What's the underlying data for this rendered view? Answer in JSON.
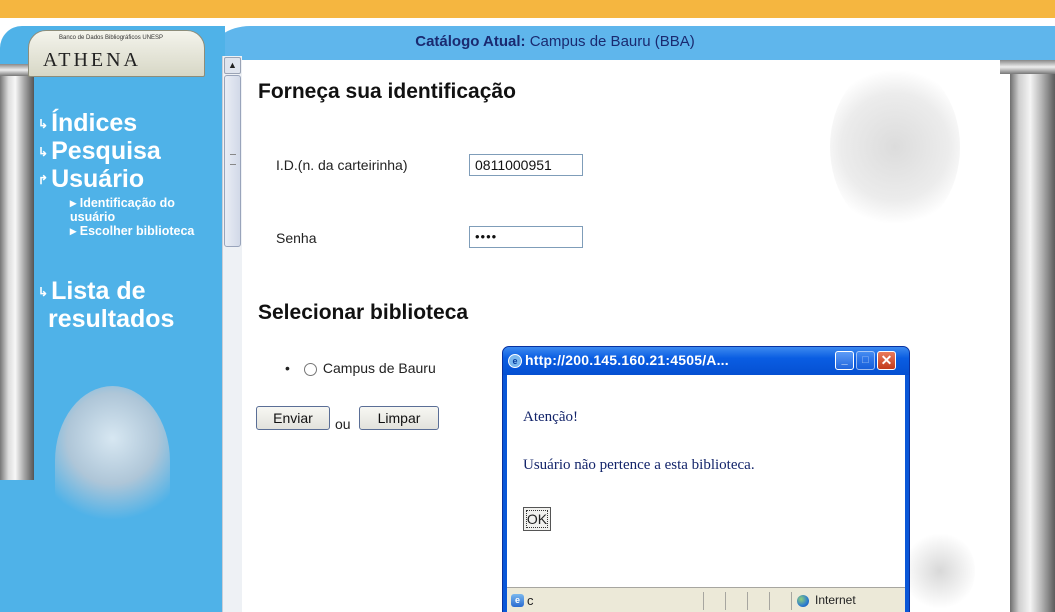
{
  "header": {
    "catalog_label": "Catálogo Atual:",
    "catalog_value": "Campus de Bauru (BBA)"
  },
  "logo": {
    "small_text": "Banco de Dados Bibliográficos UNESP",
    "name": "ATHENA"
  },
  "nav": {
    "arrow": "↳",
    "items": [
      {
        "label": "Índices"
      },
      {
        "label": "Pesquisa"
      },
      {
        "label": "Usuário"
      },
      {
        "label": "Lista de resultados"
      }
    ],
    "sub_items": [
      {
        "label": "Identificação do usuário"
      },
      {
        "label": "Escolher biblioteca"
      }
    ]
  },
  "main": {
    "heading_ident": "Forneça sua identificação",
    "id_label": "I.D.(n. da carteirinha)",
    "id_value": "0811000951",
    "senha_label": "Senha",
    "senha_value": "••••",
    "heading_lib": "Selecionar biblioteca",
    "library_option": "Campus de Bauru",
    "enviar": "Enviar",
    "ou": "ou",
    "limpar": "Limpar"
  },
  "dialog": {
    "title": "http://200.145.160.21:4505/A...",
    "atencao": "Atenção!",
    "message": "Usuário não pertence a esta biblioteca.",
    "ok": "OK",
    "status_c": "c",
    "status_zone": "Internet"
  },
  "colors": {
    "sidebar": "#4fb2e8",
    "header": "#5fb6ec",
    "top_bar": "#f5b640",
    "dialog_title": "#0a5de2"
  },
  "icons": [
    "athena-logo",
    "nav-arrow-icon",
    "scroll-up-icon",
    "radio-icon",
    "ie-icon",
    "minimize-icon",
    "maximize-icon",
    "close-icon",
    "globe-icon"
  ]
}
